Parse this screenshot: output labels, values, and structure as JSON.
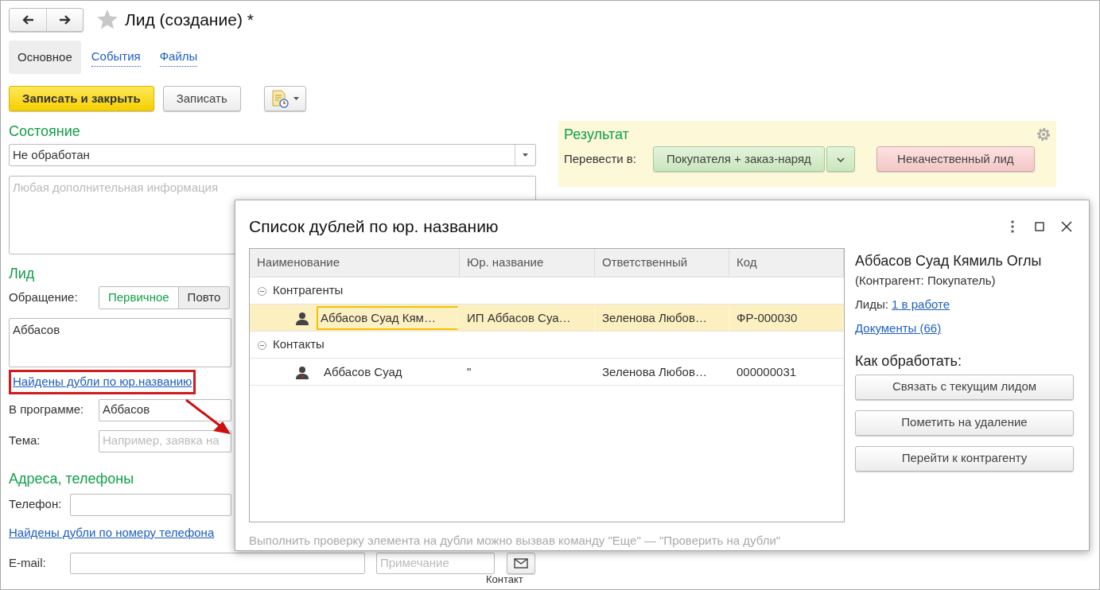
{
  "window": {
    "title": "Лид (создание) *",
    "favorite": false
  },
  "tabs": [
    {
      "label": "Основное",
      "selected": true
    },
    {
      "label": "События",
      "selected": false
    },
    {
      "label": "Файлы",
      "selected": false
    }
  ],
  "toolbar": {
    "buttons": [
      {
        "label": "Записать и закрыть",
        "kind": "primary"
      },
      {
        "label": "Записать",
        "kind": "default"
      }
    ]
  },
  "status_section": {
    "heading": "Состояние",
    "value": "Не обработан",
    "notes_placeholder": "Любая дополнительная информация"
  },
  "lead_section": {
    "heading": "Лид",
    "appeal_label": "Обращение:",
    "appeal_options": [
      {
        "label": "Первичное",
        "selected": true
      },
      {
        "label": "Повто",
        "selected": false
      }
    ],
    "name_value": "Аббасов",
    "duplicates_link": "Найдены дубли по юр.названию",
    "program_label": "В программе:",
    "program_value": "Аббасов",
    "topic_label": "Тема:",
    "topic_placeholder": "Например, заявка на"
  },
  "contacts_section": {
    "heading": "Адреса, телефоны",
    "phone_label": "Телефон:",
    "phone_duplicates_link": "Найдены дубли по номеру телефона",
    "email_label": "E-mail:",
    "note_placeholder": "Примечание",
    "contact_link": "Контакт"
  },
  "result_panel": {
    "heading": "Результат",
    "convert_label": "Перевести в:",
    "convert_button": "Покупателя + заказ-наряд",
    "reject_button": "Некачественный лид"
  },
  "dialog": {
    "title": "Список дублей по юр. названию",
    "table": {
      "columns": [
        "Наименование",
        "Юр. название",
        "Ответственный",
        "Код"
      ],
      "groups": [
        {
          "label": "Контрагенты",
          "expanded": true,
          "rows": [
            {
              "kind": "counterparty",
              "name": "Аббасов Суад Кям…",
              "legal_name": "ИП Аббасов Суа…",
              "responsible": "Зеленова Любов…",
              "code": "ФР-000030",
              "selected": true
            }
          ]
        },
        {
          "label": "Контакты",
          "expanded": true,
          "rows": [
            {
              "kind": "contact",
              "name": "Аббасов Суад",
              "legal_name": "\"",
              "responsible": "Зеленова Любов…",
              "code": "000000031",
              "selected": false
            }
          ]
        }
      ]
    },
    "details": {
      "name": "Аббасов Суад Кямиль Оглы",
      "subtitle": "(Контрагент: Покупатель)",
      "leads_label": "Лиды:",
      "leads_link": "1 в работе",
      "documents_link": "Документы (66)",
      "actions_heading": "Как обработать:",
      "actions": [
        "Связать с текущим лидом",
        "Пометить на удаление",
        "Перейти к контрагенту"
      ]
    },
    "footer_hint": "Выполнить проверку элемента на дубли можно вызвав команду \"Еще\" — \"Проверить на дубли\""
  }
}
